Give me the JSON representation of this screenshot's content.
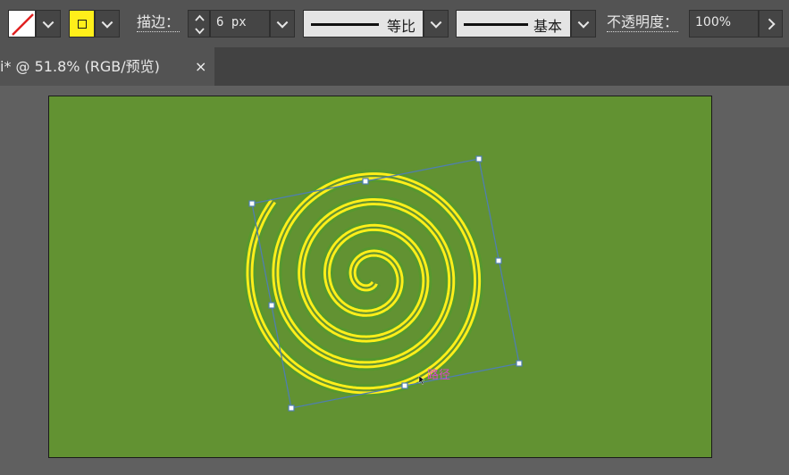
{
  "toolbar": {
    "fill_label": "",
    "stroke_label": "描边：",
    "stroke_weight": "6 px",
    "stroke_profile": "等比",
    "brush_definition": "基本",
    "opacity_label": "不透明度：",
    "opacity_value": "100%"
  },
  "document_tab": {
    "title": "i* @ 51.8% (RGB/预览)",
    "close_label": "×"
  },
  "canvas": {
    "artboard_color": "#629232",
    "path_color": "#ffef1a",
    "selection_color": "#4f7fb0",
    "cursor_label": "路径",
    "cursor_label_color": "#d64bc8"
  },
  "colors": {
    "panel_bg": "#535353",
    "tabbar_bg": "#424242",
    "workspace_bg": "#606060",
    "fill_none_slash": "#e02020",
    "stroke_swatch": "#ffef1a"
  }
}
